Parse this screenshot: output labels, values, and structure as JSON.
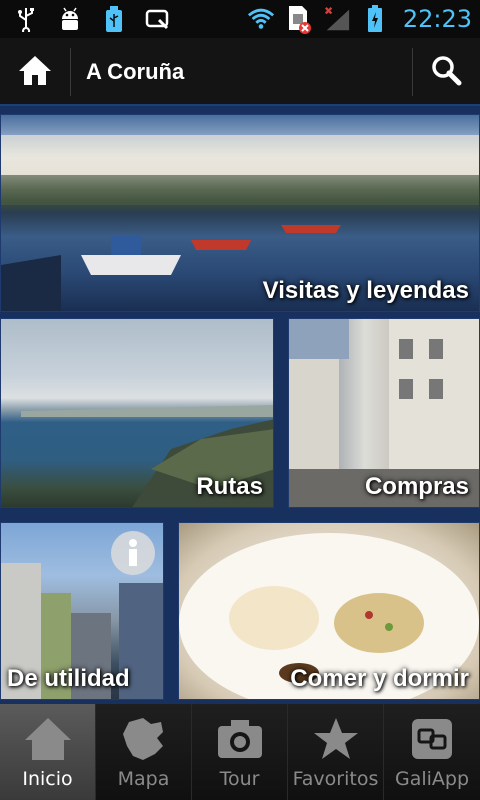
{
  "status_bar": {
    "time": "22:23",
    "icons": [
      "usb-icon",
      "android-debug-icon",
      "usb-storage-icon",
      "screenshot-icon",
      "wifi-icon",
      "sim-error-icon",
      "no-signal-icon",
      "battery-charging-icon"
    ]
  },
  "action_bar": {
    "title": "A Coruña",
    "icons": [
      "home-icon",
      "search-icon"
    ]
  },
  "tiles": [
    {
      "label": "Visitas y leyendas"
    },
    {
      "label": "Rutas"
    },
    {
      "label": "Compras"
    },
    {
      "label": "De utilidad"
    },
    {
      "label": "Comer y dormir"
    }
  ],
  "bottom_nav": {
    "items": [
      {
        "label": "Inicio",
        "icon": "house-icon",
        "active": true
      },
      {
        "label": "Mapa",
        "icon": "map-icon",
        "active": false
      },
      {
        "label": "Tour",
        "icon": "camera-icon",
        "active": false
      },
      {
        "label": "Favoritos",
        "icon": "star-icon",
        "active": false
      },
      {
        "label": "GaliApp",
        "icon": "galiapp-icon",
        "active": false
      }
    ]
  },
  "colors": {
    "accent_blue": "#17305e",
    "status_time": "#4fc3f7"
  }
}
